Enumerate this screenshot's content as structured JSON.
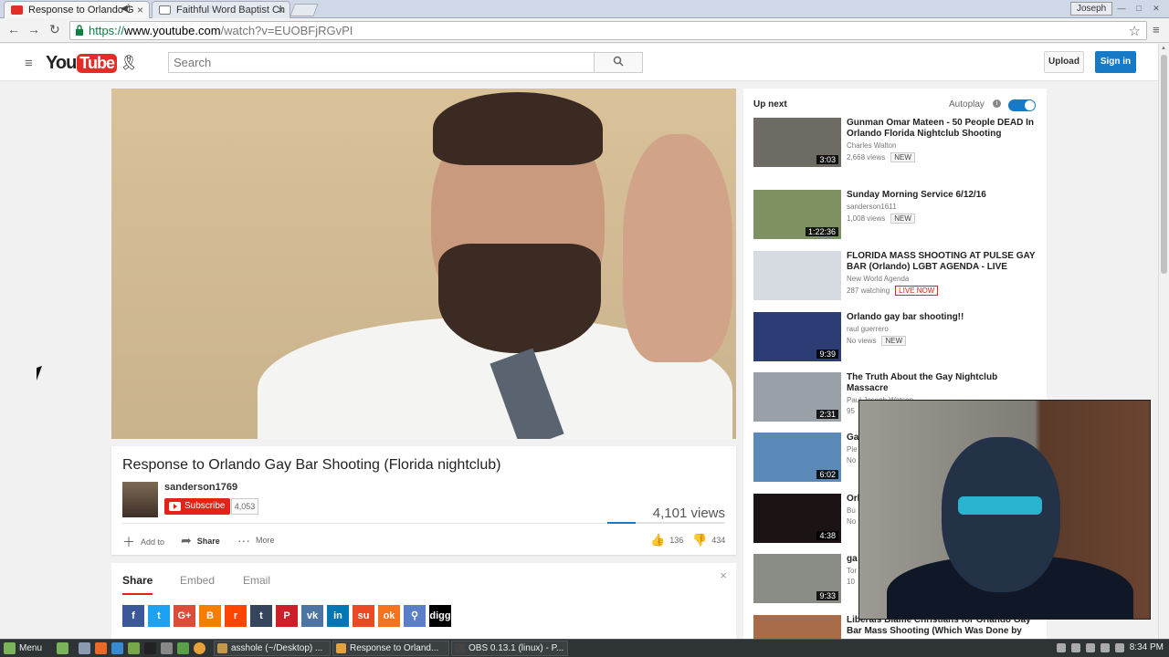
{
  "browser": {
    "tabs": [
      {
        "label": "Response to Orlando G",
        "active": true
      },
      {
        "label": "Faithful Word Baptist Ch",
        "active": false
      }
    ],
    "profile": "Joseph",
    "url": {
      "scheme": "https://",
      "host": "www.youtube.com",
      "path": "/watch?v=EUOBFjRGvPI"
    }
  },
  "youtube": {
    "logo_you": "You",
    "logo_tube": "Tube",
    "search_placeholder": "Search",
    "upload_label": "Upload",
    "signin_label": "Sign in"
  },
  "video": {
    "title": "Response to Orlando Gay Bar Shooting (Florida nightclub)",
    "channel": "sanderson1769",
    "subscribe_label": "Subscribe",
    "subscriber_count": "4,053",
    "views": "4,101 views",
    "like_ratio": 0.24,
    "actions": {
      "add_to": "Add to",
      "share": "Share",
      "more": "More"
    },
    "likes": "136",
    "dislikes": "434"
  },
  "share_panel": {
    "tabs": [
      "Share",
      "Embed",
      "Email"
    ],
    "icons": [
      {
        "name": "facebook",
        "glyph": "f",
        "color": "#3b5998"
      },
      {
        "name": "twitter",
        "glyph": "t",
        "color": "#1da1f2"
      },
      {
        "name": "google-plus",
        "glyph": "G+",
        "color": "#dd4b39"
      },
      {
        "name": "blogger",
        "glyph": "B",
        "color": "#f57d00"
      },
      {
        "name": "reddit",
        "glyph": "r",
        "color": "#ff4500"
      },
      {
        "name": "tumblr",
        "glyph": "t",
        "color": "#35465c"
      },
      {
        "name": "pinterest",
        "glyph": "P",
        "color": "#cb2027"
      },
      {
        "name": "vk",
        "glyph": "vk",
        "color": "#4c75a3"
      },
      {
        "name": "linkedin",
        "glyph": "in",
        "color": "#0077b5"
      },
      {
        "name": "stumbleupon",
        "glyph": "su",
        "color": "#eb4924"
      },
      {
        "name": "odnoklassniki",
        "glyph": "ok",
        "color": "#f4731c"
      },
      {
        "name": "link",
        "glyph": "⚲",
        "color": "#5b7ec9"
      },
      {
        "name": "digg",
        "glyph": "digg",
        "color": "#000000"
      }
    ]
  },
  "sidebar": {
    "up_next": "Up next",
    "autoplay": "Autoplay",
    "videos": [
      {
        "title": "Gunman Omar Mateen - 50 People DEAD In Orlando Florida Nightclub Shooting",
        "channel": "Charles Walton",
        "meta": "2,668 views",
        "badge": "NEW",
        "duration": "3:03",
        "thumb": "#6e6a64"
      },
      {
        "title": "Sunday Morning Service 6/12/16",
        "channel": "sanderson1611",
        "meta": "1,008 views",
        "badge": "NEW",
        "duration": "1:22:36",
        "thumb": "#7e9162"
      },
      {
        "title": "FLORIDA MASS SHOOTING AT PULSE GAY BAR (Orlando) LGBT AGENDA - LIVE",
        "channel": "New World Agenda",
        "meta": "287 watching",
        "badge": "LIVE NOW",
        "duration": "",
        "thumb": "#d6dbe1"
      },
      {
        "title": "Orlando gay bar shooting!!",
        "channel": "raul guerrero",
        "meta": "No views",
        "badge": "NEW",
        "duration": "9:39",
        "thumb": "#2b3d74"
      },
      {
        "title": "The Truth About the Gay Nightclub Massacre",
        "channel": "Paul Joseph Watson",
        "meta": "95",
        "badge": "",
        "duration": "2:31",
        "thumb": "#9aa0a8"
      },
      {
        "title": "Ga (M",
        "channel": "Pie",
        "meta": "No",
        "badge": "",
        "duration": "6:02",
        "thumb": "#5b8ab8"
      },
      {
        "title": "Orl",
        "channel": "Bu",
        "meta": "No",
        "badge": "",
        "duration": "4:38",
        "thumb": "#1c1414"
      },
      {
        "title": "ga",
        "channel": "Tor",
        "meta": "10",
        "badge": "",
        "duration": "9:33",
        "thumb": "#8a8c86"
      },
      {
        "title": "Liberals Blame Christians for Orlando Gay Bar Mass Shooting (Which Was Done by",
        "channel": "",
        "meta": "",
        "badge": "",
        "duration": "",
        "thumb": "#a86c48"
      }
    ]
  },
  "taskbar": {
    "menu": "Menu",
    "tasks": [
      {
        "label": "asshole (~/Desktop) ...",
        "color": "#c49a4a"
      },
      {
        "label": "Response to Orland...",
        "color": "#e6a23a"
      },
      {
        "label": "OBS 0.13.1 (linux) - P...",
        "color": "#444444"
      }
    ],
    "clock": "8:34 PM"
  }
}
